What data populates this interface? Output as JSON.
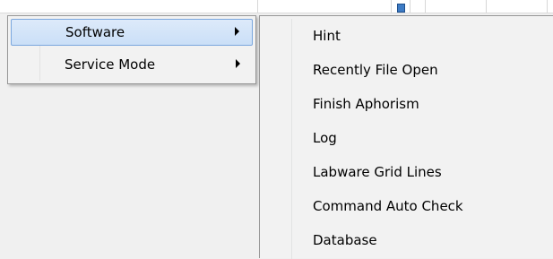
{
  "menu": {
    "items": [
      {
        "label": "Software",
        "has_submenu": true,
        "highlighted": true
      },
      {
        "label": "Service Mode",
        "has_submenu": true,
        "highlighted": false
      }
    ]
  },
  "submenu": {
    "items": [
      {
        "label": "Hint"
      },
      {
        "label": "Recently File Open"
      },
      {
        "label": "Finish Aphorism"
      },
      {
        "label": "Log"
      },
      {
        "label": "Labware Grid Lines"
      },
      {
        "label": "Command Auto Check"
      },
      {
        "label": "Database"
      }
    ]
  },
  "colors": {
    "menu_background": "#f2f2f2",
    "highlight": "#cadff7",
    "highlight_border": "#7ba7de",
    "border": "#979797"
  },
  "icons": {
    "submenu_arrow": "chevron-right-icon"
  }
}
